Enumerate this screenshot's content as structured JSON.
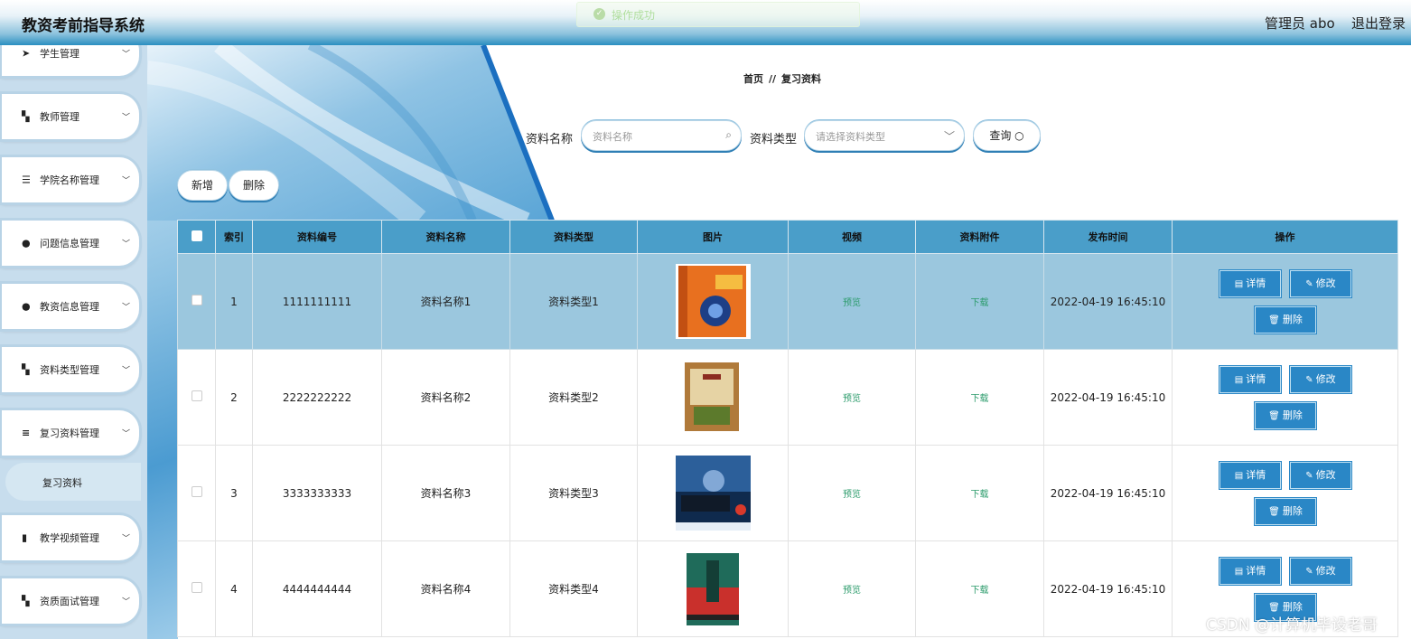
{
  "header": {
    "title": "教资考前指导系统",
    "user": "管理员 abo",
    "logout": "退出登录",
    "toast": "操作成功"
  },
  "sidebar": {
    "items": [
      {
        "icon": "paper-plane-icon",
        "glyph": "➤",
        "label": "学生管理"
      },
      {
        "icon": "grid-icon",
        "glyph": "▚",
        "label": "教师管理"
      },
      {
        "icon": "sliders-icon",
        "glyph": "☰",
        "label": "学院名称管理"
      },
      {
        "icon": "user-icon",
        "glyph": "●",
        "label": "问题信息管理"
      },
      {
        "icon": "user-icon",
        "glyph": "●",
        "label": "教资信息管理"
      },
      {
        "icon": "grid-icon",
        "glyph": "▚",
        "label": "资料类型管理"
      },
      {
        "icon": "list-icon",
        "glyph": "≡",
        "label": "复习资料管理"
      },
      {
        "icon": "bar-chart-icon",
        "glyph": "▮",
        "label": "教学视频管理"
      },
      {
        "icon": "grid-icon",
        "glyph": "▚",
        "label": "资质面试管理"
      }
    ],
    "submenu": "复习资料"
  },
  "breadcrumb": {
    "home": "首页",
    "sep": "//",
    "current": "复习资料"
  },
  "search": {
    "name_label": "资料名称",
    "name_placeholder": "资料名称",
    "type_label": "资料类型",
    "type_placeholder": "请选择资料类型",
    "query_button": "查询"
  },
  "actions": {
    "add": "新增",
    "delete": "删除"
  },
  "table": {
    "headers": [
      "索引",
      "资料编号",
      "资料名称",
      "资料类型",
      "图片",
      "视频",
      "资料附件",
      "发布时间",
      "操作"
    ],
    "rows": [
      {
        "index": "1",
        "code": "1111111111",
        "name": "资料名称1",
        "type": "资料类型1",
        "video": "预览",
        "attachment": "下载",
        "time": "2022-04-19 16:45:10"
      },
      {
        "index": "2",
        "code": "2222222222",
        "name": "资料名称2",
        "type": "资料类型2",
        "video": "预览",
        "attachment": "下载",
        "time": "2022-04-19 16:45:10"
      },
      {
        "index": "3",
        "code": "3333333333",
        "name": "资料名称3",
        "type": "资料类型3",
        "video": "预览",
        "attachment": "下载",
        "time": "2022-04-19 16:45:10"
      },
      {
        "index": "4",
        "code": "4444444444",
        "name": "资料名称4",
        "type": "资料类型4",
        "video": "预览",
        "attachment": "下载",
        "time": "2022-04-19 16:45:10"
      }
    ],
    "op_detail": "详情",
    "op_edit": "修改",
    "op_delete": "删除"
  },
  "watermark": "CSDN @计算机毕设老哥"
}
